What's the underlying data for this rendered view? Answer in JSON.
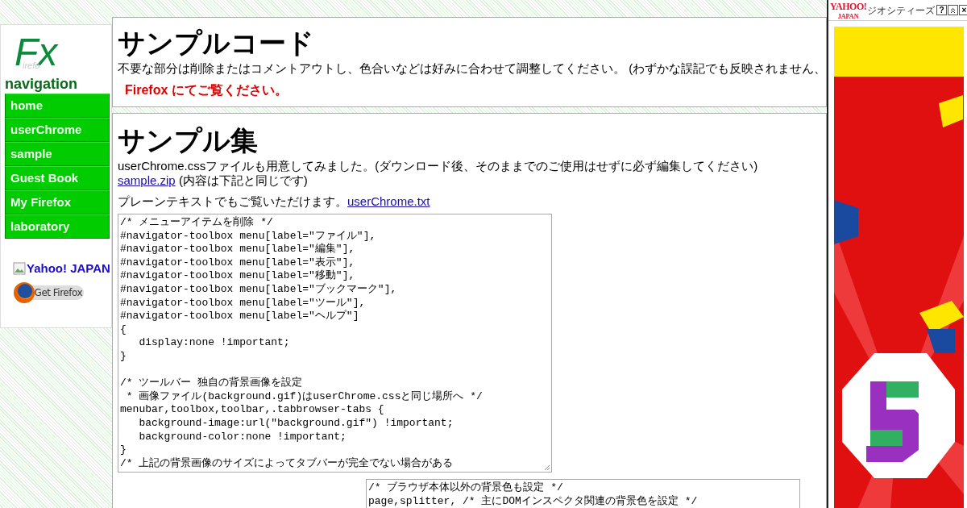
{
  "sidebar": {
    "logo": {
      "mark": "Fx",
      "subtext": "irefo"
    },
    "heading": "navigation",
    "items": [
      {
        "label": "home"
      },
      {
        "label": "userChrome"
      },
      {
        "label": "sample"
      },
      {
        "label": "Guest Book"
      },
      {
        "label": "My Firefox"
      },
      {
        "label": "laboratory"
      }
    ],
    "yahoo_link": "Yahoo! JAPAN",
    "firefox_button": "Get Firefox"
  },
  "sections": [
    {
      "title": "サンプルコード",
      "paragraph": "不要な部分は削除またはコメントアウトし、色合いなどは好みに合わせて調整してください。 (わずかな誤記でも反映されません、",
      "notice": "Firefox にてご覧ください。"
    },
    {
      "title": "サンプル集",
      "intro": "userChrome.cssファイルも用意してみました。(ダウンロード後、そのままでのご使用はせずに必ず編集してください)",
      "download_link": "sample.zip",
      "download_note": "(内容は下記と同じです)",
      "plain_text_note": "プレーンテキストでもご覧いただけます。",
      "plain_text_link": "userChrome.txt",
      "code_blocks": [
        {
          "text": "/* メニューアイテムを削除 */\n#navigator-toolbox menu[label=\"ファイル\"],\n#navigator-toolbox menu[label=\"編集\"],\n#navigator-toolbox menu[label=\"表示\"],\n#navigator-toolbox menu[label=\"移動\"],\n#navigator-toolbox menu[label=\"ブックマーク\"],\n#navigator-toolbox menu[label=\"ツール\"],\n#navigator-toolbox menu[label=\"ヘルプ\"]\n{\n   display:none !important;\n}\n\n/* ツールバー 独自の背景画像を設定\n * 画像ファイル(background.gif)はuserChrome.cssと同じ場所へ */\nmenubar,toolbox,toolbar,.tabbrowser-tabs {\n   background-image:url(\"background.gif\") !important;\n   background-color:none !important;\n}\n/* 上記の背景画像のサイズによってタブバーが完全でない場合がある"
        },
        {
          "text": "/* ブラウザ本体以外の背景色も設定 */\npage,splitter, /* 主にDOMインスペクタ関連の背景色を設定 */"
        }
      ]
    }
  ],
  "ad": {
    "logo": "YAHOO!",
    "logo_sub": "JAPAN",
    "service": "ジオシティーズ",
    "help_button": "?",
    "close_button": "×"
  }
}
